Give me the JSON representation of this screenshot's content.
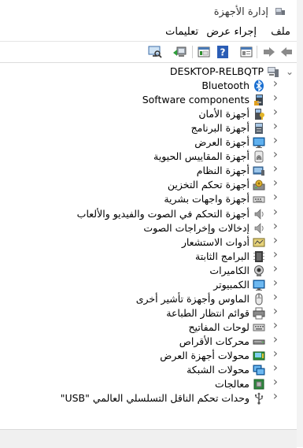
{
  "window": {
    "title": "إدارة الأجهزة"
  },
  "menu": {
    "file": "ملف",
    "action": "إجراء",
    "view": "عرض",
    "help": "تعليمات"
  },
  "tree": {
    "root": "DESKTOP-RELBQTP",
    "items": [
      {
        "label": "Bluetooth",
        "icon": "bluetooth-icon"
      },
      {
        "label": "Software components",
        "icon": "software-components-icon"
      },
      {
        "label": "أجهزة الأمان",
        "icon": "security-device-icon"
      },
      {
        "label": "أجهزة البرنامج",
        "icon": "software-device-icon"
      },
      {
        "label": "أجهزة العرض",
        "icon": "display-icon"
      },
      {
        "label": "أجهزة المقاييس الحيوية",
        "icon": "biometric-icon"
      },
      {
        "label": "أجهزة النظام",
        "icon": "system-device-icon"
      },
      {
        "label": "أجهزة تحكم التخزين",
        "icon": "storage-controller-icon"
      },
      {
        "label": "أجهزة واجهات بشرية",
        "icon": "hid-icon"
      },
      {
        "label": "أجهزة التحكم في الصوت والفيديو والألعاب",
        "icon": "sound-icon"
      },
      {
        "label": "إدخالات وإخراجات الصوت",
        "icon": "audio-io-icon"
      },
      {
        "label": "أدوات الاستشعار",
        "icon": "sensor-icon"
      },
      {
        "label": "البرامج الثابتة",
        "icon": "firmware-icon"
      },
      {
        "label": "الكاميرات",
        "icon": "camera-icon"
      },
      {
        "label": "الكمبيوتر",
        "icon": "computer-icon"
      },
      {
        "label": "الماوس وأجهزة تأشير أخرى",
        "icon": "mouse-icon"
      },
      {
        "label": "قوائم انتظار الطباعة",
        "icon": "printer-icon"
      },
      {
        "label": "لوحات المفاتيح",
        "icon": "keyboard-icon"
      },
      {
        "label": "محركات الأقراص",
        "icon": "disk-drive-icon"
      },
      {
        "label": "محولات أجهزة العرض",
        "icon": "display-adapter-icon"
      },
      {
        "label": "محولات الشبكة",
        "icon": "network-adapter-icon"
      },
      {
        "label": "معالجات",
        "icon": "processor-icon"
      },
      {
        "label": "وحدات تحكم الناقل التسلسلي العالمي \"USB\"",
        "icon": "usb-icon"
      }
    ]
  }
}
